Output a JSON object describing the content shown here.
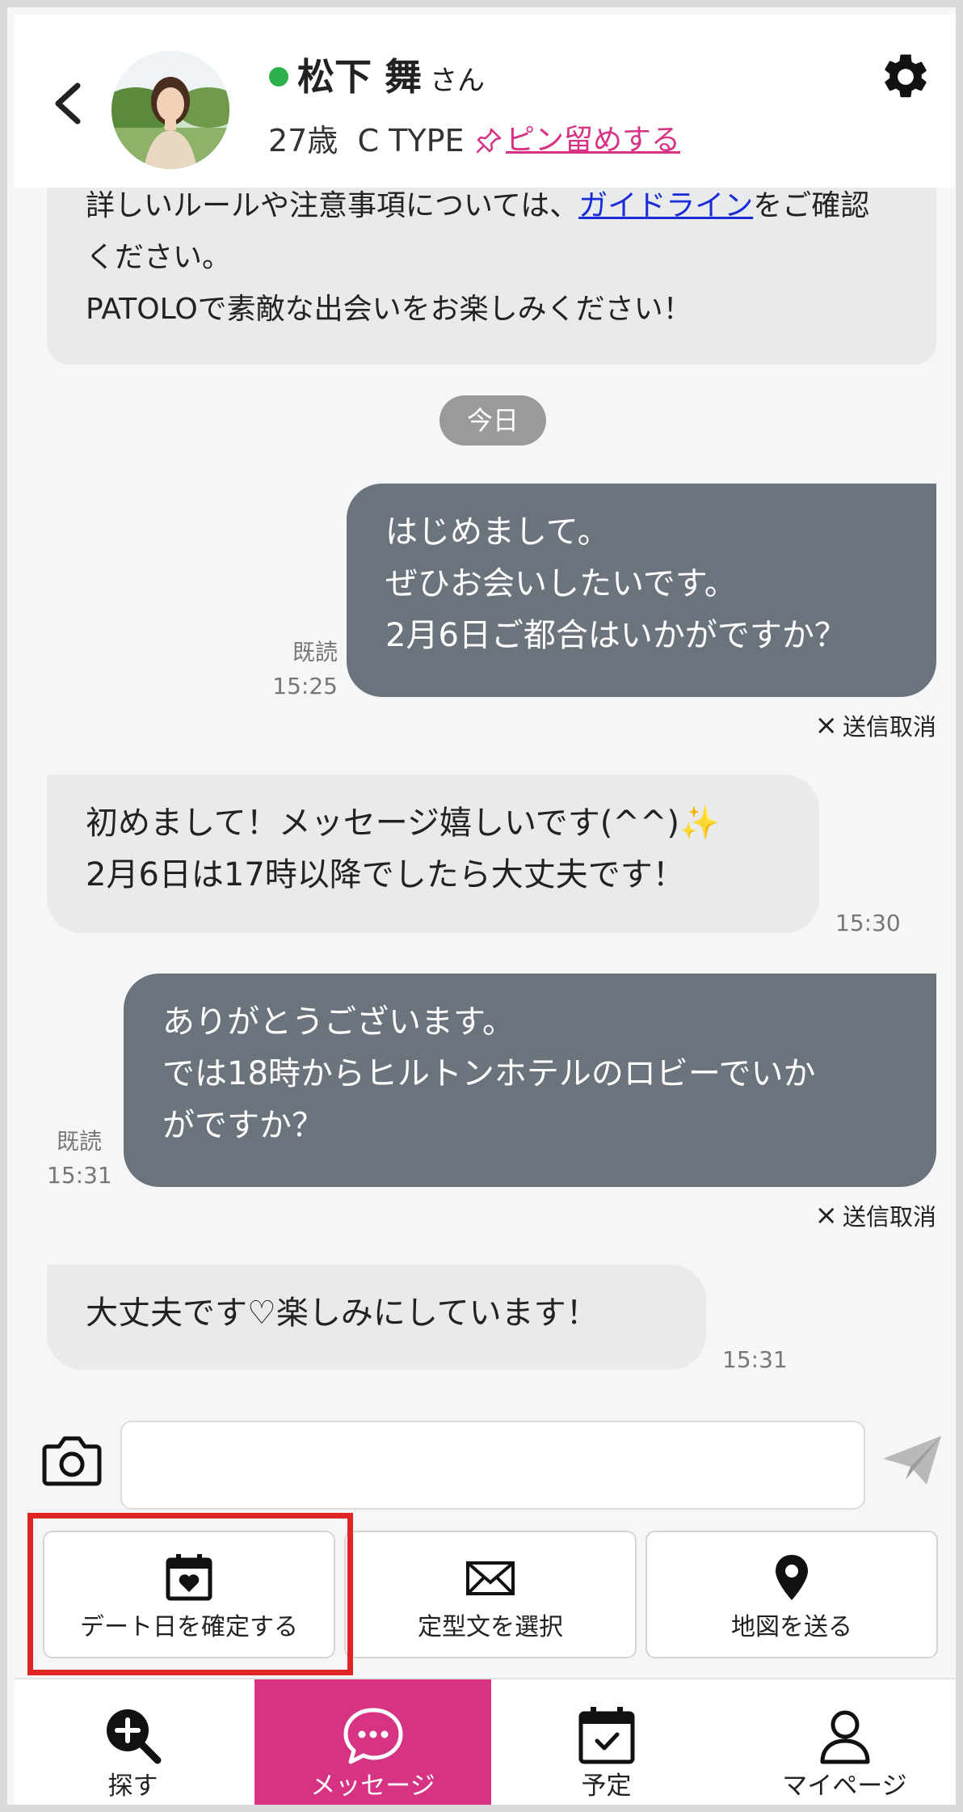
{
  "header": {
    "name": "松下 舞",
    "honorific": "さん",
    "age": "27歳",
    "type": "C TYPE",
    "pin_label": "ピン留めする",
    "online_color": "#2bb04a",
    "icons": [
      "chevron-left-icon",
      "gear-icon",
      "pin-icon"
    ]
  },
  "system_message": {
    "line1_before": "詳しいルールや注意事項については、",
    "line1_link": "ガイドライン",
    "line1_after": "をご確認",
    "line2": "ください。",
    "line3": "PATOLOで素敵な出会いをお楽しみください！"
  },
  "date_separator": "今日",
  "messages": [
    {
      "direction": "out",
      "lines": [
        "はじめまして。",
        "ぜひお会いしたいです。",
        "2月6日ご都合はいかがですか？"
      ],
      "read": "既読",
      "time": "15:25",
      "cancel": "送信取消"
    },
    {
      "direction": "in",
      "lines": [
        "初めまして！メッセージ嬉しいです(^^)✨",
        "2月6日は17時以降でしたら大丈夫です！"
      ],
      "time": "15:30"
    },
    {
      "direction": "out",
      "lines": [
        "ありがとうございます。",
        "では18時からヒルトンホテルのロビーでいか",
        "がですか？"
      ],
      "read": "既読",
      "time": "15:31",
      "cancel": "送信取消"
    },
    {
      "direction": "in",
      "lines": [
        "大丈夫です♡楽しみにしています！"
      ],
      "time": "15:31"
    }
  ],
  "composer": {
    "value": "",
    "placeholder": "",
    "icons": [
      "camera-icon",
      "send-icon"
    ]
  },
  "actions": [
    {
      "label": "デート日を確定する",
      "icon": "calendar-heart-icon",
      "highlighted": true
    },
    {
      "label": "定型文を選択",
      "icon": "envelope-icon"
    },
    {
      "label": "地図を送る",
      "icon": "map-pin-icon"
    }
  ],
  "highlight_color": "#e02525",
  "bottom_nav": [
    {
      "label": "探す",
      "icon": "search-plus-icon"
    },
    {
      "label": "メッセージ",
      "icon": "chat-bubble-icon",
      "active": true
    },
    {
      "label": "予定",
      "icon": "calendar-check-icon"
    },
    {
      "label": "マイページ",
      "icon": "user-icon"
    }
  ],
  "colors": {
    "accent": "#d63384",
    "outgoing_bubble": "#6b737d",
    "incoming_bubble": "#e9eaec",
    "link": "#1a2bd8"
  }
}
